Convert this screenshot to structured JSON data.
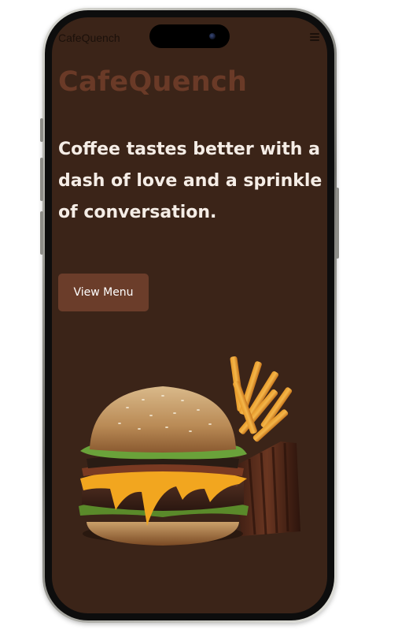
{
  "navbar": {
    "brand": "CafeQuench",
    "menu_icon": "hamburger-menu-icon"
  },
  "hero": {
    "logo_text": "CafeQuench",
    "tagline": "Coffee tastes better with a dash of love and a sprinkle of conversation.",
    "cta_label": "View Menu",
    "image_subject": "burger-and-fries"
  },
  "colors": {
    "background": "#3b2418",
    "brand_accent": "#6a3a27",
    "button": "#6b3d2a",
    "text_light": "#f5ede6"
  }
}
